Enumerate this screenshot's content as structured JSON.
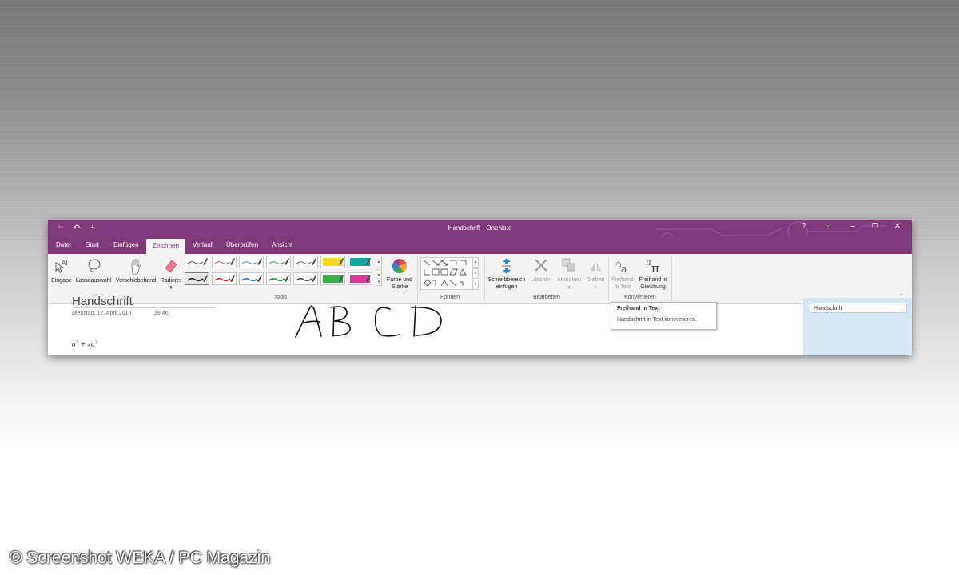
{
  "window": {
    "title": "Handschrift - OneNote",
    "help_label": "?",
    "qa_back": "⇦",
    "qa_undo": "↶",
    "qa_customize": "⇣",
    "win_min": "–",
    "win_max": "❐",
    "win_close": "✕",
    "win_fullscreen": "⊡"
  },
  "tabs": [
    {
      "label": "Datei"
    },
    {
      "label": "Start"
    },
    {
      "label": "Einfügen"
    },
    {
      "label": "Zeichnen"
    },
    {
      "label": "Verlauf"
    },
    {
      "label": "Überprüfen"
    },
    {
      "label": "Ansicht"
    }
  ],
  "ribbon": {
    "eingabe": "Eingabe",
    "lasso": "Lassoauswahl",
    "verschiebehand": "Verschiebehand",
    "radierer": "Radierer",
    "tools_group": "Tools",
    "farbe_line1": "Farbe und",
    "farbe_line2": "Stärke",
    "formen_group": "Formen",
    "schreib_line1": "Schreibbereich",
    "schreib_line2": "einfügen",
    "loeschen": "Löschen",
    "anordnen": "Anordnen",
    "drehen": "Drehen",
    "bearbeiten_group": "Bearbeiten",
    "freihand_text_line1": "Freihand",
    "freihand_text_line2": "in Text",
    "freihand_gl_line1": "Freihand in",
    "freihand_gl_line2": "Gleichung",
    "konvertieren_group": "Konvertieren",
    "pen_colors_row1": [
      "#444444",
      "#e04040",
      "#3a8fd6",
      "#2f9a55",
      "#666666",
      "#f3dc1b",
      "#12a8a0"
    ],
    "pen_colors_row2": [
      "#222222",
      "#d42424",
      "#2a6fc0",
      "#1e8a3e",
      "#555555",
      "#36b24a",
      "#d63a9a"
    ]
  },
  "tooltip": {
    "title": "Freihand in Text",
    "description": "Handschrift in Text konvertieren."
  },
  "page": {
    "title": "Handschrift",
    "date": "Dienstag, 12. April 2016",
    "time": "19:46",
    "handwriting": "ABCD"
  },
  "pagelist": {
    "item": "Handschrift"
  },
  "colors": {
    "accent": "#80397b",
    "ribbon_bg": "#f3f3f3",
    "pagelist_bg": "#d7e6f5"
  },
  "copyright": "© Screenshot WEKA / PC Magazin"
}
